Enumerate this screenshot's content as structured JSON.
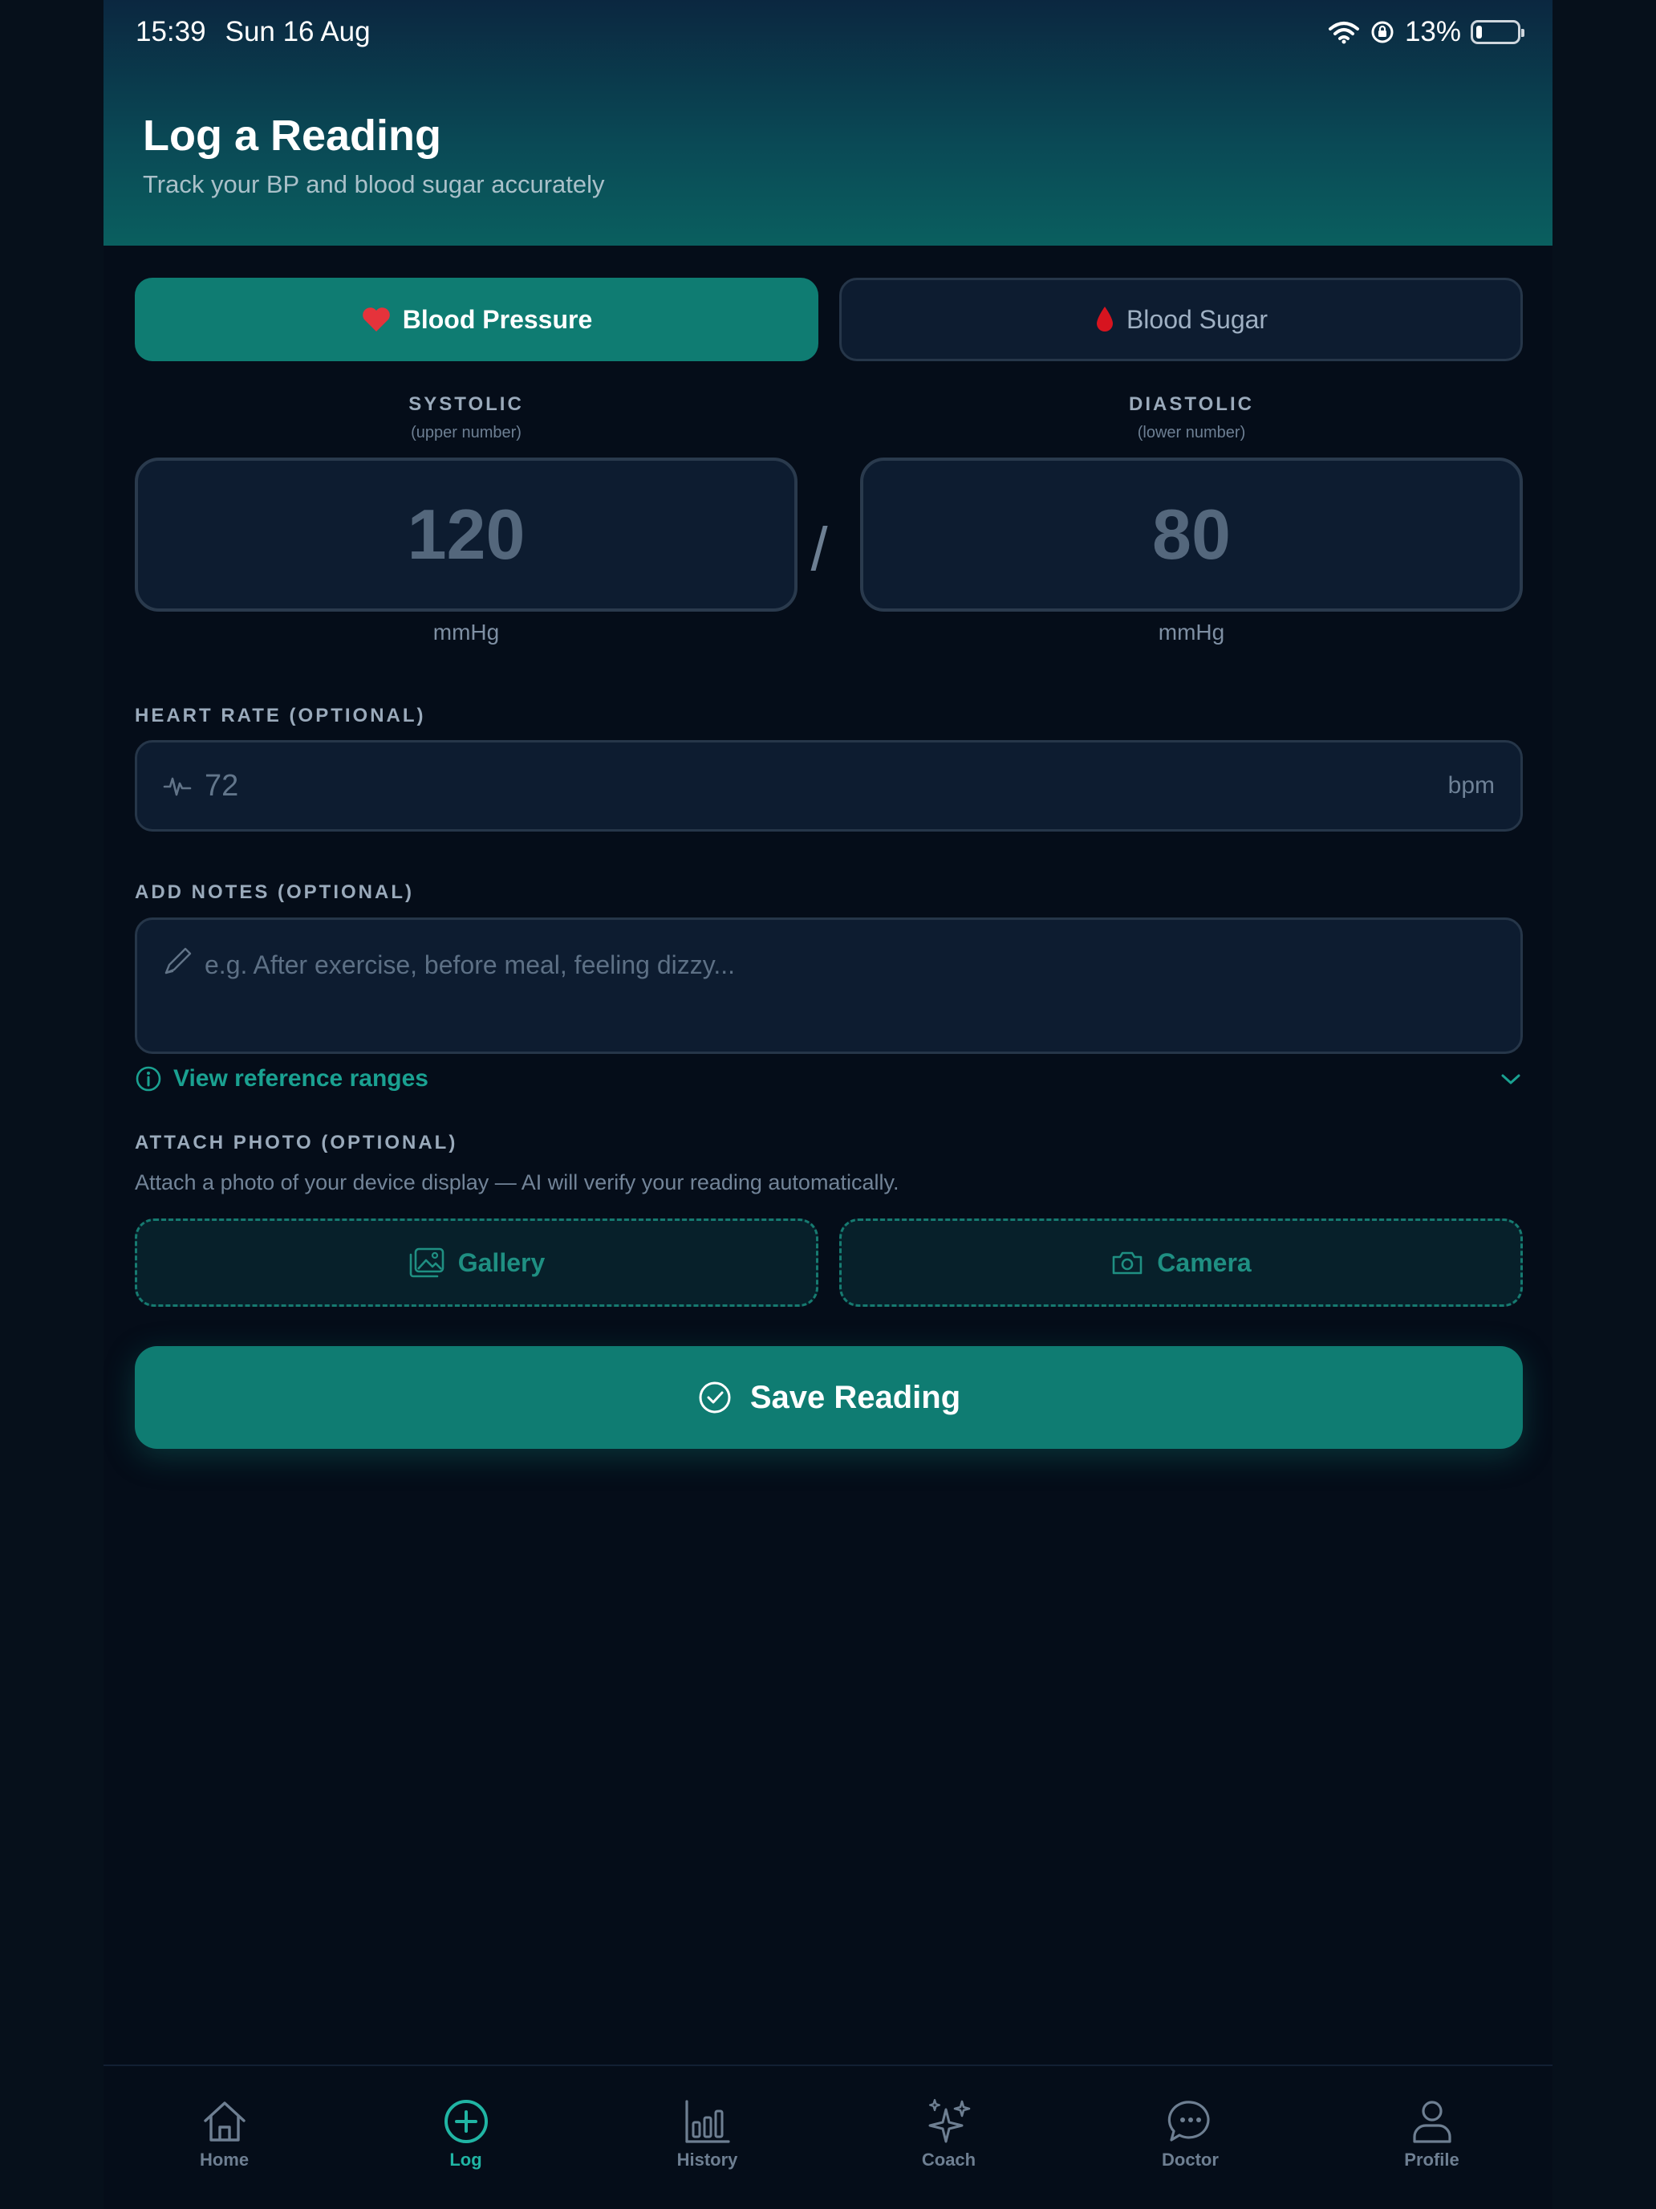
{
  "status_bar": {
    "time": "15:39",
    "date": "Sun 16 Aug",
    "battery": "13%",
    "battery_level": 0.13
  },
  "header": {
    "title": "Log a Reading",
    "subtitle": "Track your BP and blood sugar accurately"
  },
  "segments": [
    {
      "label": "Blood Pressure",
      "icon": "heart-icon",
      "active": true
    },
    {
      "label": "Blood Sugar",
      "icon": "blood-drop-icon",
      "active": false
    }
  ],
  "systolic": {
    "label": "SYSTOLIC",
    "sublabel": "(upper number)",
    "placeholder": "120",
    "unit": "mmHg"
  },
  "diastolic": {
    "label": "DIASTOLIC",
    "sublabel": "(lower number)",
    "placeholder": "80",
    "unit": "mmHg"
  },
  "separator": "/",
  "heart_rate": {
    "label": "HEART RATE (OPTIONAL)",
    "placeholder": "72",
    "unit": "bpm",
    "icon": "pulse-icon"
  },
  "notes": {
    "label": "ADD NOTES (OPTIONAL)",
    "placeholder": "e.g. After exercise, before meal, feeling dizzy...",
    "icon": "pencil-icon"
  },
  "reference": {
    "label": "View reference ranges",
    "icon": "info-icon"
  },
  "attach": {
    "label": "ATTACH PHOTO (OPTIONAL)",
    "hint": "Attach a photo of your device display — AI will verify your reading automatically.",
    "gallery": "Gallery",
    "camera": "Camera"
  },
  "save_label": "Save Reading",
  "tabs": [
    {
      "label": "Home",
      "icon": "home-icon",
      "active": false
    },
    {
      "label": "Log",
      "icon": "plus-circle-icon",
      "active": true
    },
    {
      "label": "History",
      "icon": "bar-chart-icon",
      "active": false
    },
    {
      "label": "Coach",
      "icon": "sparkles-icon",
      "active": false
    },
    {
      "label": "Doctor",
      "icon": "chat-bubble-icon",
      "active": false
    },
    {
      "label": "Profile",
      "icon": "user-icon",
      "active": false
    }
  ],
  "colors": {
    "accent": "#0f7c72",
    "accent_text": "#1aa191",
    "background": "#050d19",
    "field": "#0d1c30"
  }
}
